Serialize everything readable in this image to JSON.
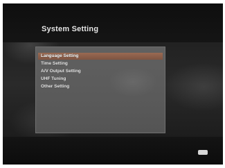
{
  "screen": {
    "title": "System Setting"
  },
  "menu": {
    "items": [
      {
        "label": "Language Setting",
        "selected": true
      },
      {
        "label": "Time Setting",
        "selected": false
      },
      {
        "label": "A/V Output Setting",
        "selected": false
      },
      {
        "label": "UHF Tuning",
        "selected": false
      },
      {
        "label": "Other Setting",
        "selected": false
      }
    ]
  },
  "colors": {
    "selection": "#8a5e48",
    "panel": "#5c5c5c",
    "background": "#1c1c1c"
  },
  "icons": {
    "ok_badge": "ok-button-icon"
  }
}
